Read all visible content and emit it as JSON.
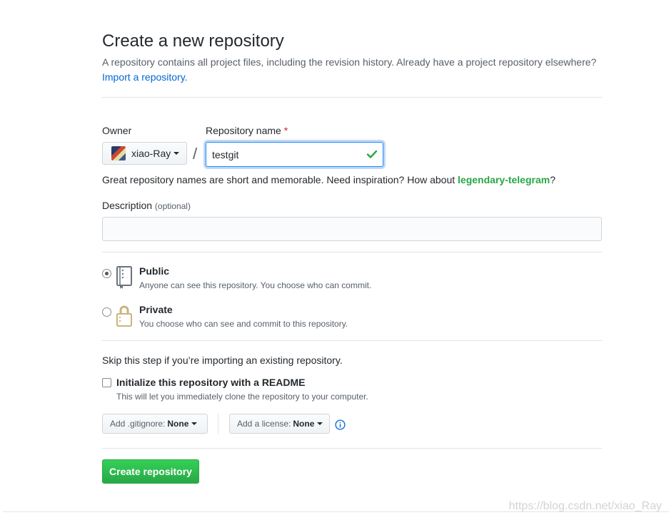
{
  "header": {
    "title": "Create a new repository",
    "subtitle": "A repository contains all project files, including the revision history. Already have a project repository elsewhere?",
    "import_link": "Import a repository."
  },
  "owner": {
    "label": "Owner",
    "value": "xiao-Ray"
  },
  "repo_name": {
    "label": "Repository name",
    "required_mark": "*",
    "value": "testgit",
    "separator": "/"
  },
  "hint": {
    "text": "Great repository names are short and memorable. Need inspiration? How about ",
    "suggestion": "legendary-telegram",
    "suffix": "?"
  },
  "description": {
    "label": "Description",
    "optional": "(optional)",
    "value": ""
  },
  "visibility": {
    "public": {
      "title": "Public",
      "note": "Anyone can see this repository. You choose who can commit.",
      "selected": true
    },
    "private": {
      "title": "Private",
      "note": "You choose who can see and commit to this repository.",
      "selected": false
    }
  },
  "init": {
    "skip_text": "Skip this step if you’re importing an existing repository.",
    "readme_label": "Initialize this repository with a README",
    "readme_note": "This will let you immediately clone the repository to your computer.",
    "readme_checked": false
  },
  "gitignore": {
    "label": "Add .gitignore:",
    "value": "None"
  },
  "license": {
    "label": "Add a license:",
    "value": "None"
  },
  "submit": {
    "label": "Create repository"
  },
  "watermark": "https://blog.csdn.net/xiao_Ray",
  "colors": {
    "link": "#0366d6",
    "primary_button": "#28a745",
    "suggestion": "#28a745",
    "required": "#cb2431",
    "focus_border": "#2188ff"
  },
  "icons": {
    "repo_public": "repo-icon",
    "repo_private": "lock-icon",
    "validation": "check-icon",
    "info": "info-icon"
  }
}
